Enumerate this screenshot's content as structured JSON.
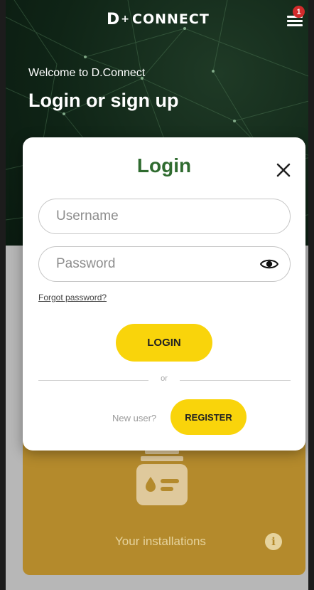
{
  "header": {
    "logo_text": "CONNECT",
    "logo_letter": "D",
    "logo_plus": "+",
    "notification_count": "1"
  },
  "hero": {
    "welcome": "Welcome to D.Connect",
    "heading": "Login or sign up"
  },
  "modal": {
    "title": "Login",
    "username_placeholder": "Username",
    "password_placeholder": "Password",
    "forgot_password": "Forgot password?",
    "login_label": "LOGIN",
    "or_label": "or",
    "new_user_label": "New user?",
    "register_label": "REGISTER"
  },
  "installations": {
    "label": "Your installations",
    "info_glyph": "i"
  },
  "colors": {
    "accent_yellow": "#f9d40b",
    "title_green": "#2f6b2f",
    "card_gold": "#b48a2c",
    "badge_red": "#d12b2b"
  },
  "icons": [
    "menu-icon",
    "close-icon",
    "eye-icon",
    "installation-icon",
    "info-icon"
  ]
}
